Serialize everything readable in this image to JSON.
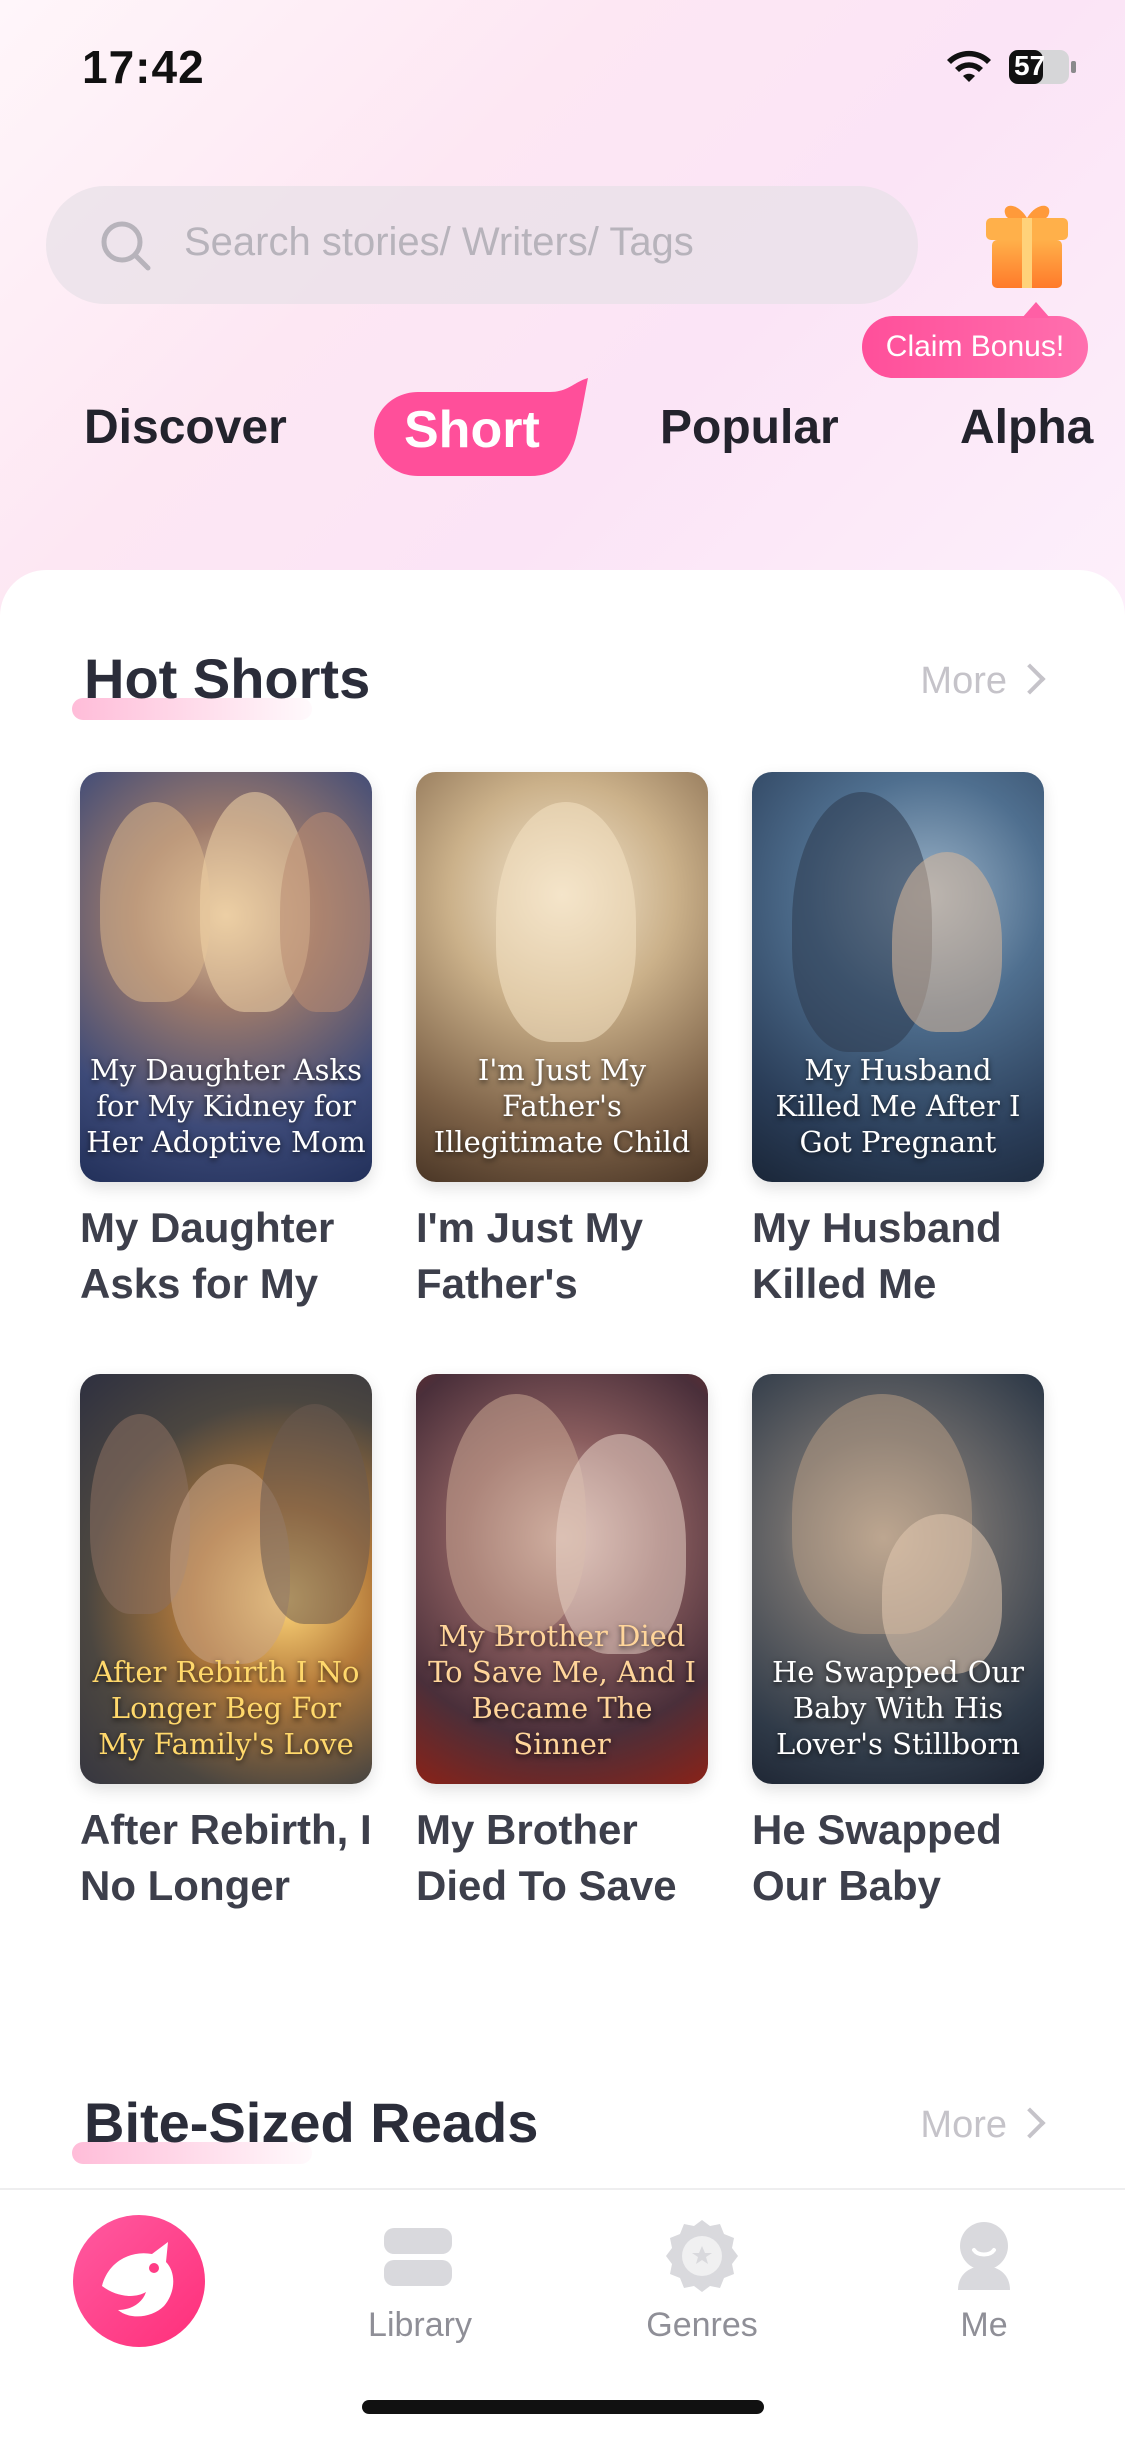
{
  "status_bar": {
    "time": "17:42",
    "battery": "57"
  },
  "search": {
    "placeholder": "Search stories/ Writers/ Tags"
  },
  "bonus": {
    "label": "Claim Bonus!"
  },
  "tabs": [
    {
      "label": "Discover",
      "active": false
    },
    {
      "label": "Short",
      "active": true
    },
    {
      "label": "Popular",
      "active": false
    },
    {
      "label": "Alpha",
      "active": false
    }
  ],
  "sections": {
    "hot_shorts": {
      "title": "Hot Shorts",
      "more": "More",
      "books": [
        {
          "title": "My Daughter Asks for My",
          "cover_text": "My Daughter Asks for My Kidney for Her Adoptive Mom"
        },
        {
          "title": "I'm Just My Father's",
          "cover_text": "I'm Just My Father's Illegitimate Child"
        },
        {
          "title": "My Husband Killed Me",
          "cover_text": "My Husband Killed Me After I Got Pregnant"
        },
        {
          "title": "After Rebirth, I No Longer",
          "cover_text": "After Rebirth I No Longer Beg For My Family's Love"
        },
        {
          "title": "My Brother Died To Save",
          "cover_text": "My Brother Died To Save Me, And I Became The Sinner"
        },
        {
          "title": "He Swapped Our Baby",
          "cover_text": "He Swapped Our Baby With His Lover's Stillborn"
        }
      ]
    },
    "bite_sized": {
      "title": "Bite-Sized Reads",
      "more": "More"
    }
  },
  "bottom_nav": {
    "library": "Library",
    "genres": "Genres",
    "me": "Me"
  },
  "colors": {
    "accent_pink": "#ff4f9a",
    "text_dark": "#2b2d3a",
    "muted": "#c5c3c9"
  }
}
